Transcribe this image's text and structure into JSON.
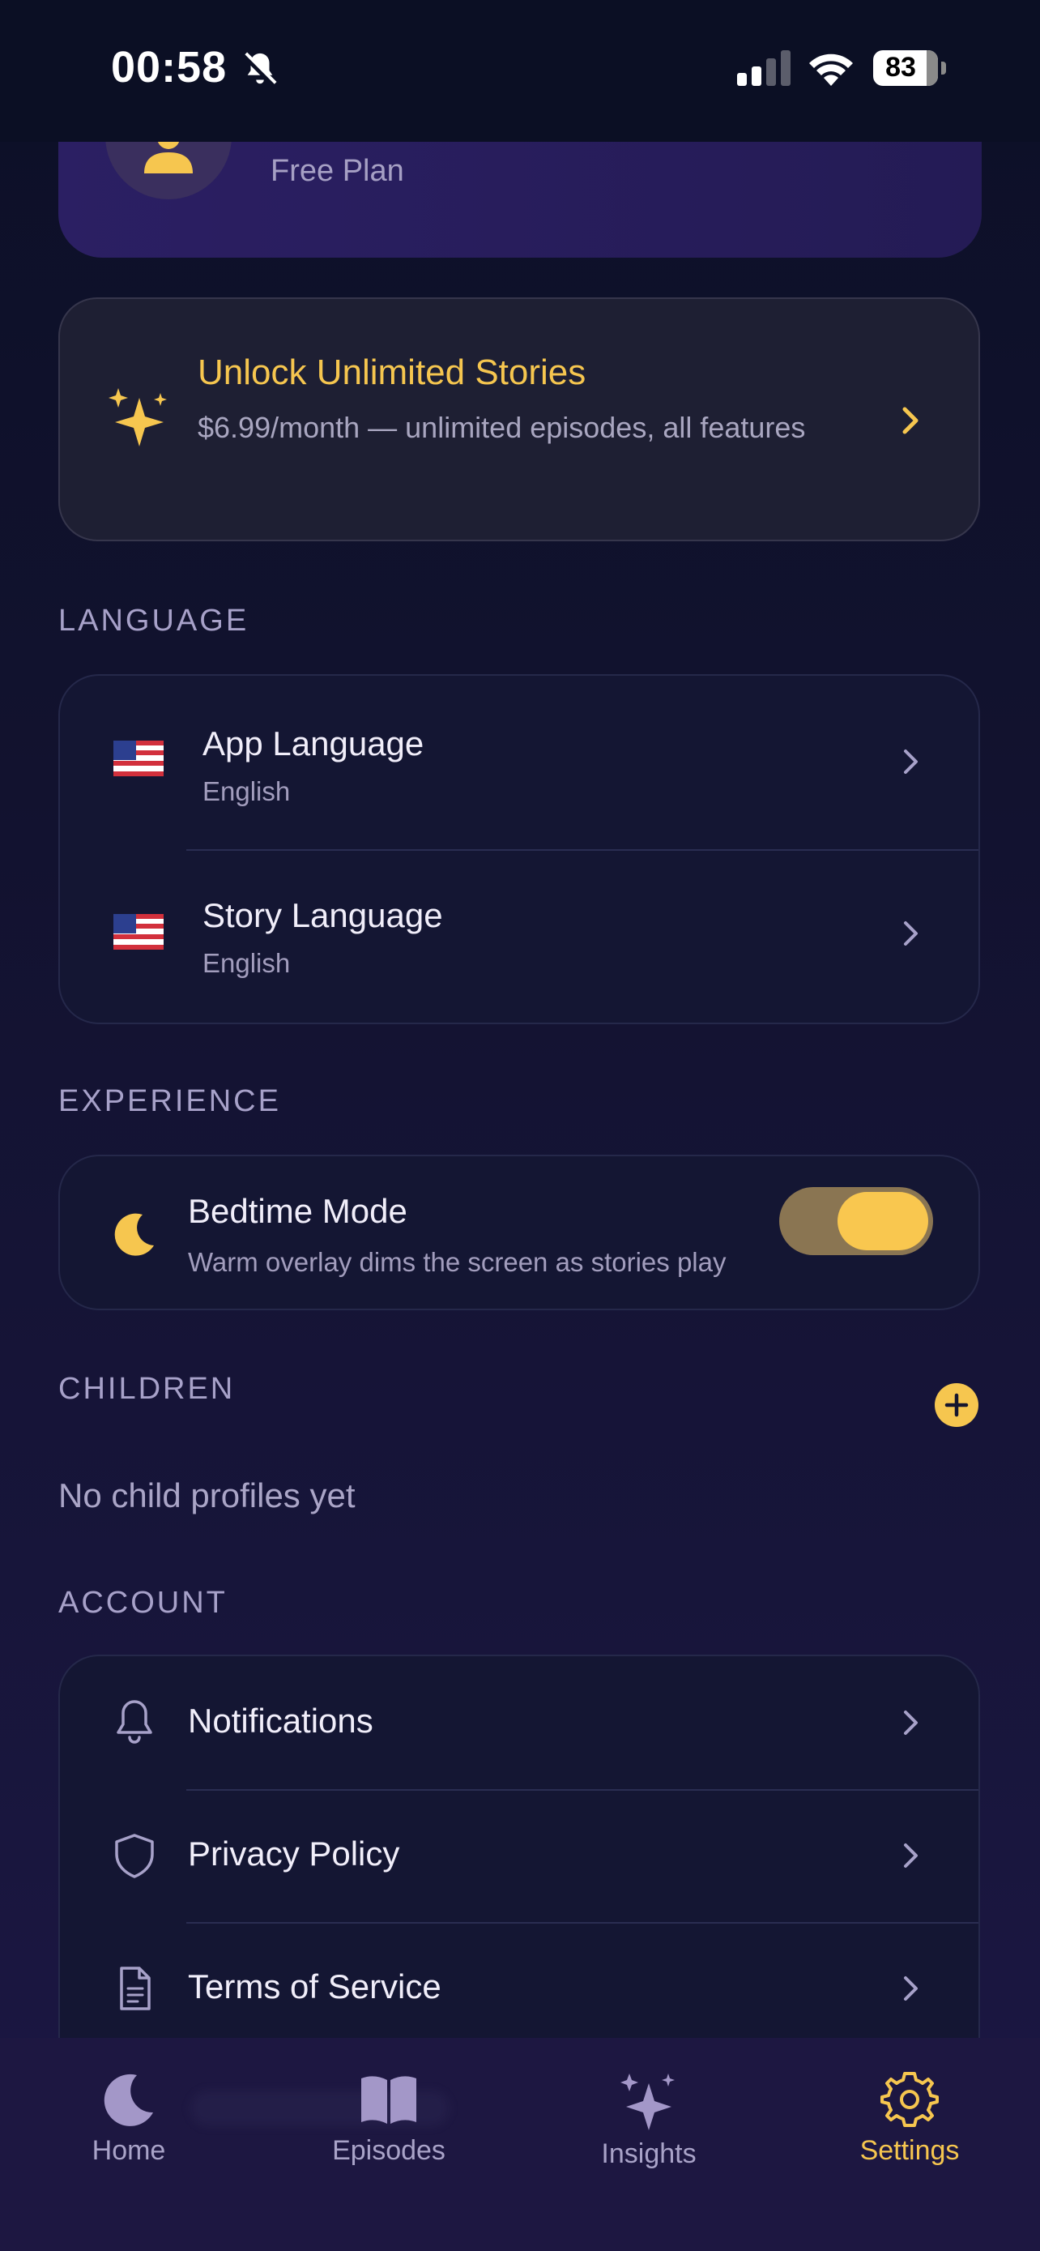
{
  "status_bar": {
    "time": "00:58",
    "battery": "83",
    "icons": [
      "bell-slash-icon",
      "signal-icon",
      "wifi-icon",
      "battery-icon"
    ]
  },
  "profile": {
    "plan": "Free Plan",
    "avatar_icon": "person-icon"
  },
  "premium": {
    "title": "Unlock Unlimited Stories",
    "subtitle": "$6.99/month — unlimited episodes, all features",
    "icon": "sparkles-icon"
  },
  "sections": {
    "language": "LANGUAGE",
    "experience": "EXPERIENCE",
    "children": "CHILDREN",
    "account": "ACCOUNT"
  },
  "language": {
    "app": {
      "title": "App Language",
      "value": "English",
      "flag": "🇺🇸"
    },
    "story": {
      "title": "Story Language",
      "value": "English",
      "flag": "🇺🇸"
    }
  },
  "experience": {
    "bedtime": {
      "title": "Bedtime Mode",
      "subtitle": "Warm overlay dims the screen as stories play",
      "enabled": true
    }
  },
  "children": {
    "empty": "No child profiles yet"
  },
  "account": {
    "items": [
      {
        "label": "Notifications",
        "icon": "bell-icon"
      },
      {
        "label": "Privacy Policy",
        "icon": "shield-icon"
      },
      {
        "label": "Terms of Service",
        "icon": "document-icon"
      }
    ]
  },
  "tabs": [
    {
      "label": "Home",
      "icon": "moon-icon",
      "active": false
    },
    {
      "label": "Episodes",
      "icon": "book-icon",
      "active": false
    },
    {
      "label": "Insights",
      "icon": "sparkles-icon",
      "active": false
    },
    {
      "label": "Settings",
      "icon": "gear-icon",
      "active": true
    }
  ],
  "colors": {
    "accent": "#f6c64f",
    "background": "#12122f",
    "card": "#141633",
    "text_muted": "#a7a1c9"
  }
}
